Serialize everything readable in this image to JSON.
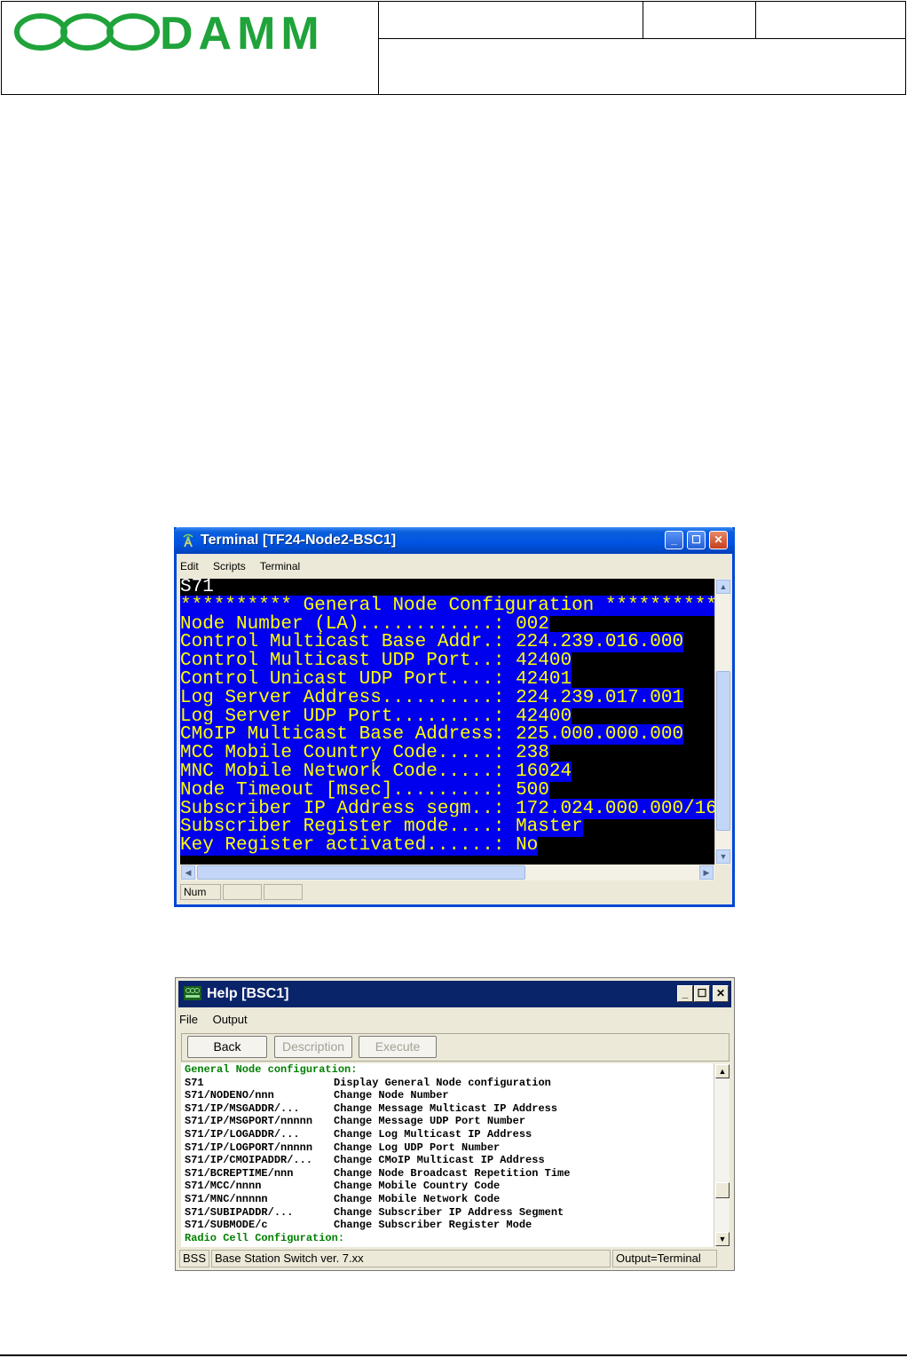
{
  "document": {
    "logo_text": "DAMM"
  },
  "terminal": {
    "title": "Terminal [TF24-Node2-BSC1]",
    "menu": [
      "Edit",
      "Scripts",
      "Terminal"
    ],
    "command": "S71",
    "header_line": "********** General Node Configuration ***********",
    "rows": [
      {
        "label": "Node Number (LA)............: ",
        "value": "002"
      },
      {
        "label": "Control Multicast Base Addr.: ",
        "value": "224.239.016.000"
      },
      {
        "label": "Control Multicast UDP Port..: ",
        "value": "42400"
      },
      {
        "label": "Control Unicast UDP Port....: ",
        "value": "42401"
      },
      {
        "label": "Log Server Address..........: ",
        "value": "224.239.017.001"
      },
      {
        "label": "Log Server UDP Port.........: ",
        "value": "42400"
      },
      {
        "label": "CMoIP Multicast Base Address: ",
        "value": "225.000.000.000"
      },
      {
        "label": "MCC Mobile Country Code.....: ",
        "value": "238"
      },
      {
        "label": "MNC Mobile Network Code.....: ",
        "value": "16024"
      },
      {
        "label": "Node Timeout [msec].........: ",
        "value": "500"
      },
      {
        "label": "Subscriber IP Address segm..: ",
        "value": "172.024.000.000/16"
      },
      {
        "label": "Subscriber Register mode....: ",
        "value": "Master"
      },
      {
        "label": "Key Register activated......: ",
        "value": "No"
      }
    ],
    "status": "Num"
  },
  "help": {
    "title": "Help [BSC1]",
    "menu": [
      "File",
      "Output"
    ],
    "buttons": {
      "back": "Back",
      "description": "Description",
      "execute": "Execute"
    },
    "section1": "General Node configuration:",
    "entries": [
      {
        "cmd": "S71",
        "desc": "Display General Node configuration"
      },
      {
        "cmd": "S71/NODENO/nnn",
        "desc": "Change Node Number"
      },
      {
        "cmd": "S71/IP/MSGADDR/...",
        "desc": "Change Message Multicast IP Address"
      },
      {
        "cmd": "S71/IP/MSGPORT/nnnnn",
        "desc": "Change Message UDP Port Number"
      },
      {
        "cmd": "S71/IP/LOGADDR/...",
        "desc": "Change Log Multicast IP Address"
      },
      {
        "cmd": "S71/IP/LOGPORT/nnnnn",
        "desc": "Change Log UDP Port Number"
      },
      {
        "cmd": "S71/IP/CMOIPADDR/...",
        "desc": "Change CMoIP Multicast IP Address"
      },
      {
        "cmd": "S71/BCREPTIME/nnn",
        "desc": "Change Node Broadcast Repetition Time"
      },
      {
        "cmd": "S71/MCC/nnnn",
        "desc": "Change Mobile Country Code"
      },
      {
        "cmd": "S71/MNC/nnnnn",
        "desc": "Change Mobile Network Code"
      },
      {
        "cmd": "S71/SUBIPADDR/...",
        "desc": "Change Subscriber IP Address Segment"
      },
      {
        "cmd": "S71/SUBMODE/c",
        "desc": "Change Subscriber Register Mode"
      }
    ],
    "section2": "Radio Cell Configuration:",
    "status_left": "BSS",
    "status_mid": "Base Station Switch ver. 7.xx",
    "status_right": "Output=Terminal"
  },
  "colors": {
    "logo_green": "#1fa33a",
    "terminal_text": "#ffff00",
    "terminal_highlight": "#0000ee",
    "help_section": "#008000"
  }
}
